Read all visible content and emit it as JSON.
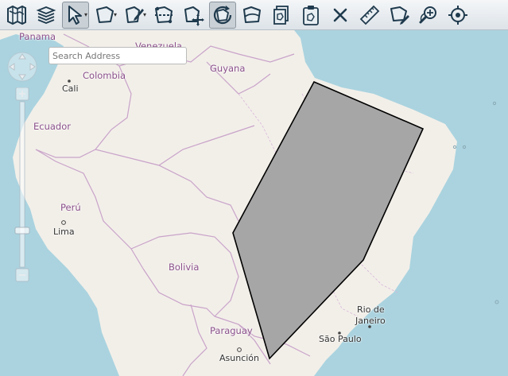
{
  "toolbar": {
    "tools": [
      {
        "name": "map-icon"
      },
      {
        "name": "layers-icon"
      },
      {
        "name": "select-pointer-icon",
        "active": true,
        "caret": true
      },
      {
        "name": "draw-polygon-icon",
        "caret": true
      },
      {
        "name": "edit-polygon-icon",
        "caret": true
      },
      {
        "name": "cut-polygon-icon"
      },
      {
        "name": "move-polygon-icon"
      },
      {
        "name": "rotate-polygon-icon",
        "active": true
      },
      {
        "name": "reshape-polygon-icon"
      },
      {
        "name": "copy-icon"
      },
      {
        "name": "paste-icon"
      },
      {
        "name": "delete-icon"
      },
      {
        "name": "measure-ruler-icon"
      },
      {
        "name": "edit-attributes-icon"
      },
      {
        "name": "zoom-to-selection-icon"
      },
      {
        "name": "locate-icon"
      }
    ]
  },
  "search": {
    "placeholder": "Search Address"
  },
  "labels": {
    "panama": "Panama",
    "venezuela": "Venezuela",
    "guyana": "Guyana",
    "colombia": "Colombia",
    "cali": "Cali",
    "ecuador": "Ecuador",
    "peru": "Perú",
    "lima": "Lima",
    "bolivia": "Bolivia",
    "paraguay": "Paraguay",
    "asuncion": "Asunción",
    "rio": "Rio de",
    "rio2": "Janeiro",
    "saopaulo": "São Paulo"
  },
  "colors": {
    "water": "#aad3df",
    "land": "#f2efe9",
    "border": "#c9a3c9",
    "polygon_fill": "#a6a6a6",
    "polygon_stroke": "#000000",
    "icon": "#1f3a4d"
  }
}
